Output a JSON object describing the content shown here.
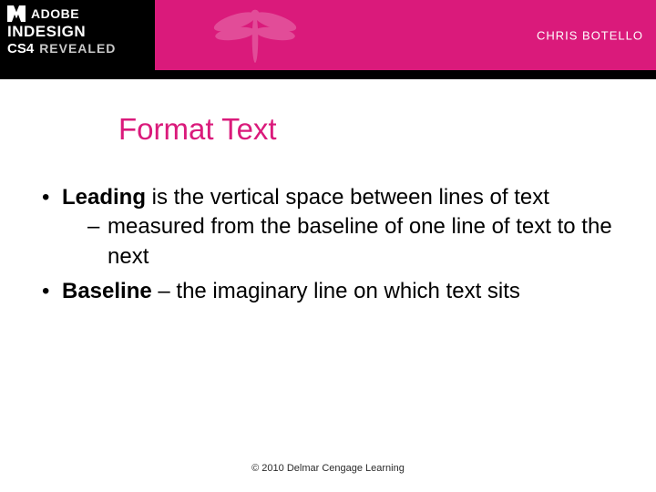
{
  "header": {
    "brand_line1": "ADOBE",
    "brand_line2": "INDESIGN",
    "brand_cs": "CS4",
    "brand_revealed": "REVEALED",
    "author": "CHRIS BOTELLO"
  },
  "slide": {
    "title": "Format Text",
    "bullets": [
      {
        "term": "Leading",
        "rest": " is the vertical space between lines of text",
        "sub": [
          "measured from the baseline of one line of text to the next"
        ]
      },
      {
        "term": "Baseline",
        "rest": " – the imaginary line on which text sits",
        "sub": []
      }
    ]
  },
  "footer": {
    "copyright": "© 2010 Delmar Cengage Learning"
  }
}
